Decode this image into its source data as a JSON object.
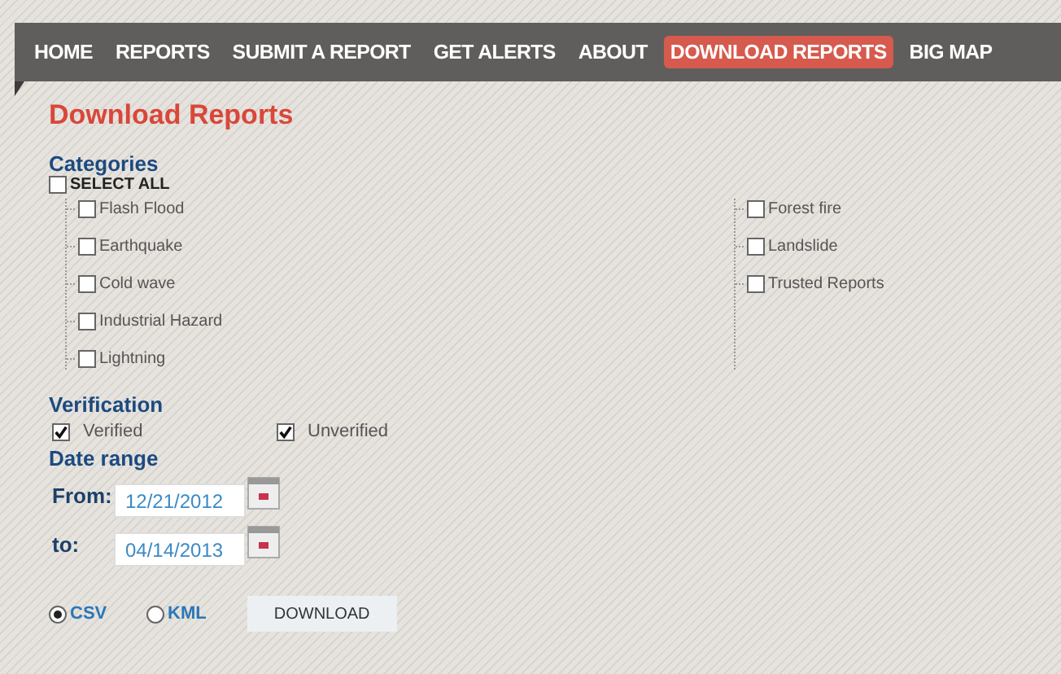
{
  "nav": [
    {
      "label": "HOME",
      "selected": false
    },
    {
      "label": "REPORTS",
      "selected": false
    },
    {
      "label": "SUBMIT A REPORT",
      "selected": false
    },
    {
      "label": "GET ALERTS",
      "selected": false
    },
    {
      "label": "ABOUT",
      "selected": false
    },
    {
      "label": "DOWNLOAD REPORTS",
      "selected": true
    },
    {
      "label": "BIG MAP",
      "selected": false
    }
  ],
  "title": "Download Reports",
  "categories": {
    "heading": "Categories",
    "select_all": {
      "label": "SELECT ALL",
      "checked": false
    },
    "columns": [
      [
        {
          "label": "Flash Flood",
          "checked": false
        },
        {
          "label": "Earthquake",
          "checked": false
        },
        {
          "label": "Cold wave",
          "checked": false
        },
        {
          "label": "Industrial Hazard",
          "checked": false
        },
        {
          "label": "Lightning",
          "checked": false
        }
      ],
      [
        {
          "label": "Forest fire",
          "checked": false
        },
        {
          "label": "Landslide",
          "checked": false
        },
        {
          "label": "Trusted Reports",
          "checked": false
        }
      ]
    ]
  },
  "verification": {
    "heading": "Verification",
    "options": [
      {
        "label": "Verified",
        "checked": true
      },
      {
        "label": "Unverified",
        "checked": true
      }
    ]
  },
  "date_range": {
    "heading": "Date range",
    "fields": [
      {
        "label": "From:",
        "value": "12/21/2012"
      },
      {
        "label": "to:",
        "value": "04/14/2013"
      }
    ]
  },
  "formats": [
    {
      "label": "CSV",
      "selected": true
    },
    {
      "label": "KML",
      "selected": false
    }
  ],
  "download_button": "DOWNLOAD"
}
